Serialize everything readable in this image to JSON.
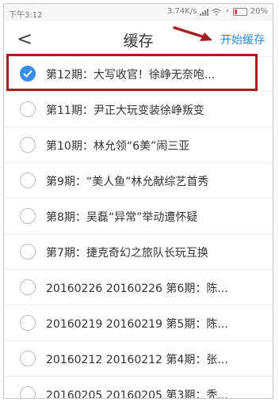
{
  "status": {
    "time": "下午3:12",
    "speed": "3.74K/s",
    "battery": "20%"
  },
  "header": {
    "back_label": "<",
    "title": "缓存",
    "start_cache_label": "开始缓存"
  },
  "episodes": [
    {
      "label": "第12期：大写收官！徐峥无奈咆...",
      "checked": true
    },
    {
      "label": "第11期：尹正大玩变装徐峥叛变",
      "checked": false
    },
    {
      "label": "第10期：林允领“6美”闹三亚",
      "checked": false
    },
    {
      "label": "第9期：“美人鱼”林允献综艺首秀",
      "checked": false
    },
    {
      "label": "第8期：吴磊“异常”举动遭怀疑",
      "checked": false
    },
    {
      "label": "第7期：捷克奇幻之旅队长玩互换",
      "checked": false
    },
    {
      "label": "20160226 20160226 第6期：陈...",
      "checked": false
    },
    {
      "label": "20160219 20160219 第5期：陈...",
      "checked": false
    },
    {
      "label": "20160212 20160212 第4期：张...",
      "checked": false
    },
    {
      "label": "20160205 20160205 第3期：秃...",
      "checked": false
    }
  ],
  "colors": {
    "accent": "#2f88e0",
    "checked": "#3a8ee6",
    "annotation": "#a32022"
  }
}
